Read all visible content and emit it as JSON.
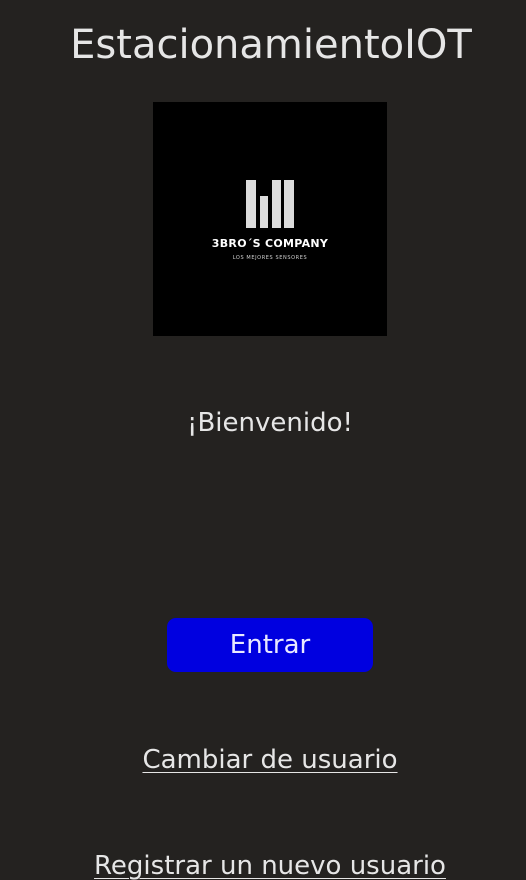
{
  "app": {
    "title": "EstacionamientoIOT"
  },
  "logo": {
    "company_name": "3BRO´S COMPANY",
    "tagline": "LOS MEJORES SENSORES",
    "icon": "three-bars-logo-icon"
  },
  "welcome": {
    "text": "¡Bienvenido!"
  },
  "actions": {
    "enter_label": "Entrar",
    "switch_user_label": "Cambiar de usuario",
    "register_label": "Registrar un nuevo usuario"
  },
  "colors": {
    "background": "#242220",
    "primary_button": "#0000e0",
    "text": "#e6e6e6"
  }
}
